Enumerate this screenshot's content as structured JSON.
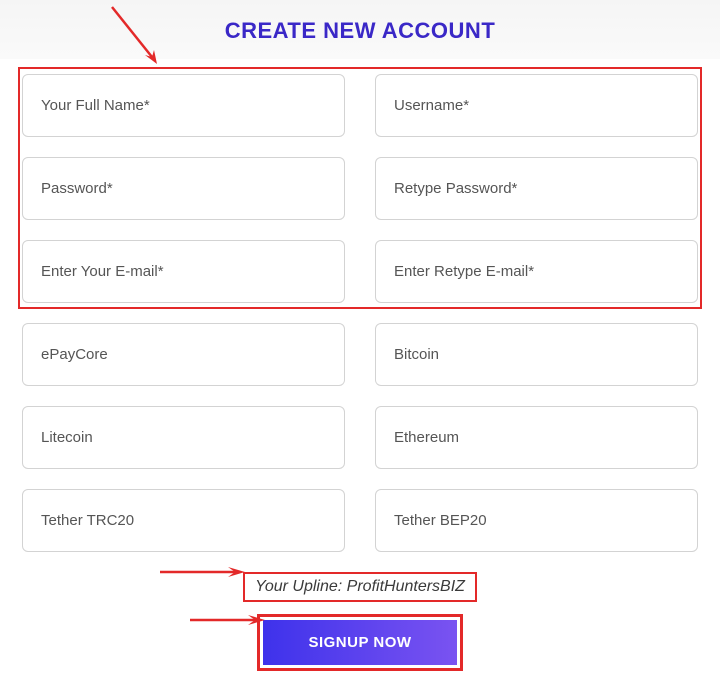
{
  "header": {
    "title": "CREATE NEW ACCOUNT"
  },
  "fields": {
    "fullname": "Your Full Name*",
    "username": "Username*",
    "password": "Password*",
    "retypePassword": "Retype Password*",
    "email": "Enter Your E-mail*",
    "retypeEmail": "Enter Retype E-mail*",
    "epaycore": "ePayCore",
    "bitcoin": "Bitcoin",
    "litecoin": "Litecoin",
    "ethereum": "Ethereum",
    "tetherTrc20": "Tether TRC20",
    "tetherBep20": "Tether BEP20"
  },
  "upline": "Your Upline: ProfitHuntersBIZ",
  "signup": "SIGNUP NOW",
  "colors": {
    "accent": "#3a28c7",
    "highlight": "#e32929",
    "buttonStart": "#3e32eb",
    "buttonEnd": "#7a53f1"
  }
}
